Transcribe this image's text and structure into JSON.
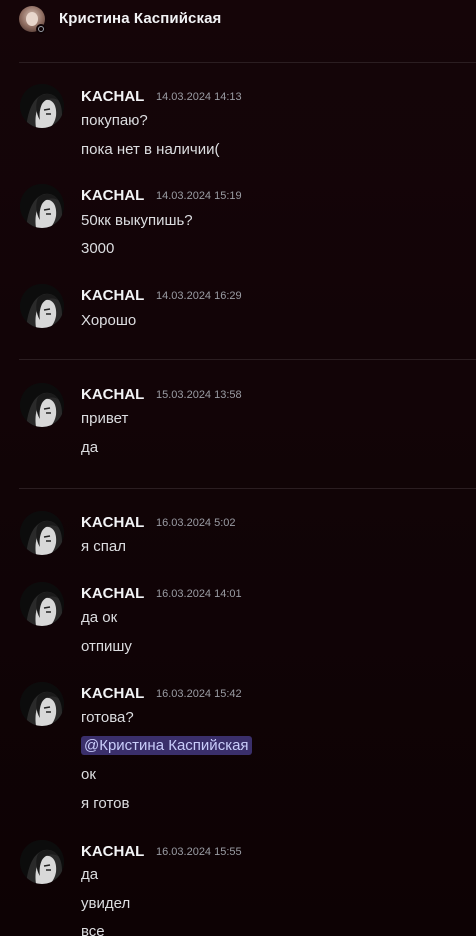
{
  "header": {
    "title": "Кристина Каспийская"
  },
  "messages": [
    {
      "author": "KACHAL",
      "time": "14.03.2024 14:13",
      "lines": [
        "покупаю?",
        "пока нет в наличии("
      ]
    },
    {
      "author": "KACHAL",
      "time": "14.03.2024 15:19",
      "lines": [
        "50кк выкупишь?",
        "3000"
      ]
    },
    {
      "author": "KACHAL",
      "time": "14.03.2024 16:29",
      "lines": [
        "Хорошо"
      ]
    },
    {
      "author": "KACHAL",
      "time": "15.03.2024 13:58",
      "lines": [
        "привет",
        "да"
      ]
    },
    {
      "author": "KACHAL",
      "time": "16.03.2024 5:02",
      "lines": [
        "я спал"
      ]
    },
    {
      "author": "KACHAL",
      "time": "16.03.2024 14:01",
      "lines": [
        "да ок",
        "отпишу"
      ]
    },
    {
      "author": "KACHAL",
      "time": "16.03.2024 15:42",
      "lines": [
        "готова?",
        "@Кристина Каспийская",
        "ок",
        "я готов"
      ]
    },
    {
      "author": "KACHAL",
      "time": "16.03.2024 15:55",
      "lines": [
        "да",
        "увидел",
        "все"
      ]
    }
  ]
}
